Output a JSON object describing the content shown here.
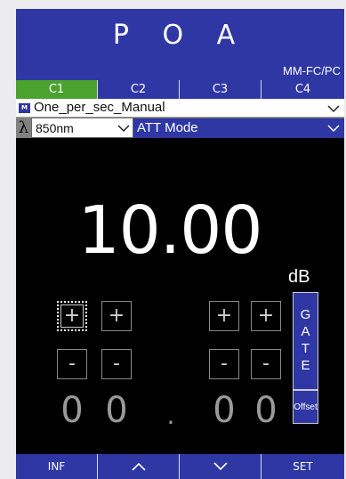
{
  "header": {
    "title": "P O A",
    "connector": "MM-FC/PC"
  },
  "tabs": [
    {
      "label": "C1",
      "active": true
    },
    {
      "label": "C2",
      "active": false
    },
    {
      "label": "C3",
      "active": false
    },
    {
      "label": "C4",
      "active": false
    }
  ],
  "profile": {
    "badge": "M",
    "name": "One_per_sec_Manual"
  },
  "wavelength": {
    "symbol": "λ",
    "value": "850nm"
  },
  "mode": {
    "value": "ATT Mode"
  },
  "reading": {
    "value": "10.00",
    "unit": "dB"
  },
  "adjust": {
    "plus": "+",
    "minus": "-"
  },
  "gate": {
    "letters": [
      "G",
      "A",
      "T",
      "E"
    ]
  },
  "offset": {
    "label": "Offset"
  },
  "setpoint": {
    "d1": "0",
    "d2": "0",
    "dot": ".",
    "d3": "0",
    "d4": "0"
  },
  "footer": {
    "inf": "INF",
    "up": "up-arrow-icon",
    "down": "down-arrow-icon",
    "set": "SET"
  },
  "colors": {
    "header_blue": "#2f37a5",
    "active_tab": "#4ca22f"
  }
}
